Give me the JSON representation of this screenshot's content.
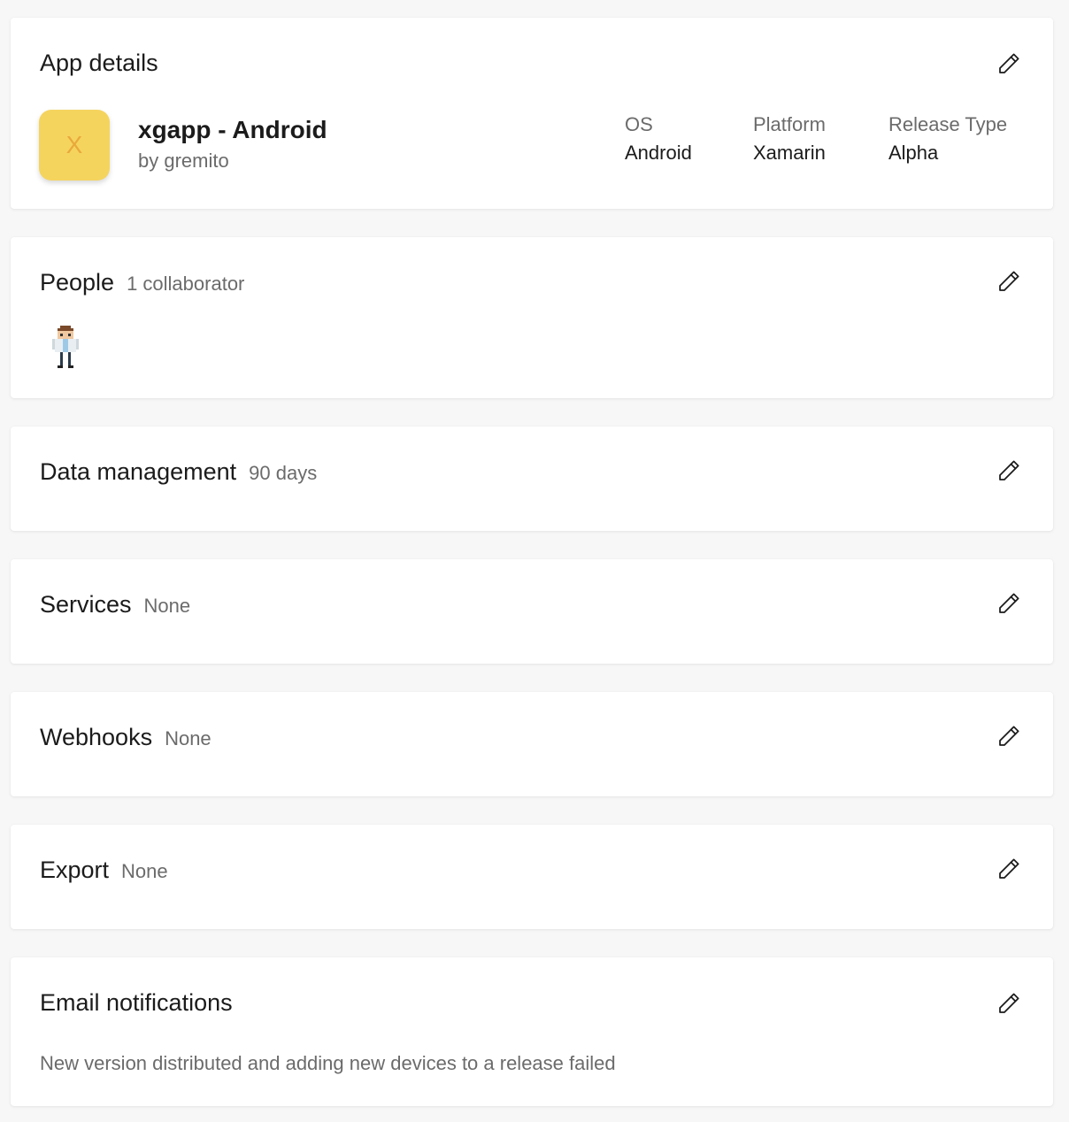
{
  "app_details": {
    "title": "App details",
    "app_icon_letter": "X",
    "app_name": "xgapp - Android",
    "owner": "by gremito",
    "details": [
      {
        "label": "OS",
        "value": "Android"
      },
      {
        "label": "Platform",
        "value": "Xamarin"
      },
      {
        "label": "Release Type",
        "value": "Alpha"
      }
    ],
    "icon_bg_color": "#f5d45e",
    "edit_icon": "pencil-icon"
  },
  "people": {
    "title": "People",
    "subtitle": "1 collaborator",
    "avatar_icon": "pixel-avatar-icon",
    "edit_icon": "pencil-icon"
  },
  "data_management": {
    "title": "Data management",
    "subtitle": "90 days",
    "edit_icon": "pencil-icon"
  },
  "services": {
    "title": "Services",
    "subtitle": "None",
    "edit_icon": "pencil-icon"
  },
  "webhooks": {
    "title": "Webhooks",
    "subtitle": "None",
    "edit_icon": "pencil-icon"
  },
  "export": {
    "title": "Export",
    "subtitle": "None",
    "edit_icon": "pencil-icon"
  },
  "email_notifications": {
    "title": "Email notifications",
    "description": "New version distributed and adding new devices to a release failed",
    "edit_icon": "pencil-icon"
  }
}
